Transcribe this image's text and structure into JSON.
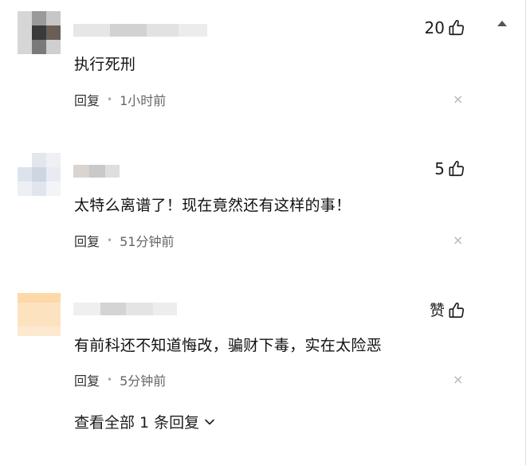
{
  "comments": [
    {
      "text": "执行死刑",
      "likes": "20",
      "reply_label": "回复",
      "time": "1小时前",
      "close_glyph": "×",
      "like_icon": "thumbs-up-icon"
    },
    {
      "text": "太特么离谱了！现在竟然还有这样的事！",
      "likes": "5",
      "reply_label": "回复",
      "time": "51分钟前",
      "close_glyph": "×",
      "like_icon": "thumbs-up-icon"
    },
    {
      "text": "有前科还不知道悔改，骗财下毒，实在太险恶",
      "likes": "赞",
      "reply_label": "回复",
      "time": "5分钟前",
      "close_glyph": "×",
      "like_icon": "thumbs-up-icon"
    }
  ],
  "more_replies": {
    "label": "查看全部 1 条回复",
    "icon": "chevron-down-icon"
  },
  "collapse_icon": "caret-up-icon",
  "colors": {
    "text": "#111111",
    "meta": "#666666",
    "close": "#b5b5b5",
    "avatar_1": "#6b6b6b",
    "avatar_2": "#dde3ee",
    "avatar_3": "#fde2c0"
  }
}
